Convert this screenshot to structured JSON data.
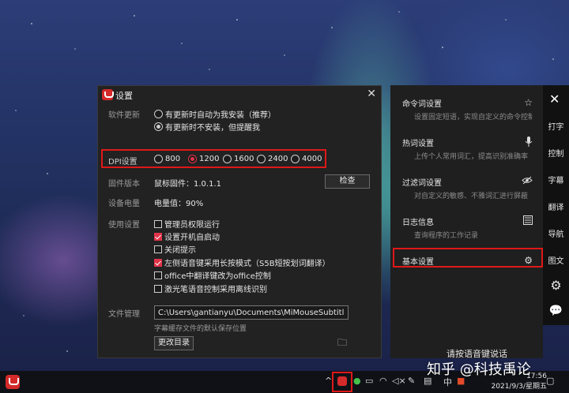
{
  "window": {
    "title": "设置",
    "software_update": {
      "label": "软件更新",
      "option_auto": "有更新时自动为我安装（推荐）",
      "option_notify": "有更新时不安装，但提醒我",
      "selected": "option_notify"
    },
    "dpi": {
      "label": "DPI设置",
      "options": [
        "800",
        "1200",
        "1600",
        "2400",
        "4000"
      ],
      "selected": "1200"
    },
    "firmware": {
      "label": "固件版本",
      "value": "鼠标固件：1.0.1.1",
      "check_button": "检查"
    },
    "battery": {
      "label": "设备电量",
      "value": "电量值：90%"
    },
    "usage": {
      "label": "使用设置",
      "options": [
        {
          "text": "管理员权限运行",
          "checked": false
        },
        {
          "text": "设置开机自启动",
          "checked": true
        },
        {
          "text": "关闭提示",
          "checked": false
        },
        {
          "text": "左侧语音键采用长按模式（S5B短按划词翻译）",
          "checked": true
        },
        {
          "text": "office中翻译键改为office控制",
          "checked": false
        },
        {
          "text": "激光笔语音控制采用离线识别",
          "checked": false
        }
      ]
    },
    "file_management": {
      "label": "文件管理",
      "path": "C:\\Users\\gantianyu\\Documents\\MiMouseSubtitle",
      "hint": "字幕缓存文件的默认保存位置",
      "change_button": "更改目录"
    }
  },
  "panel": {
    "items": [
      {
        "title": "命令词设置",
        "subtitle": "设置固定短语，实现自定义的命令控制",
        "icon": "star-icon"
      },
      {
        "title": "热词设置",
        "subtitle": "上传个人常用词汇，提高识别准确率",
        "icon": "microphone-icon"
      },
      {
        "title": "过滤词设置",
        "subtitle": "对自定义的敏感、不雅词汇进行屏蔽",
        "icon": "eye-off-icon"
      },
      {
        "title": "日志信息",
        "subtitle": "查询程序的工作记录",
        "icon": "log-icon"
      },
      {
        "title": "基本设置",
        "subtitle": "",
        "icon": "gear-icon"
      }
    ],
    "footer": "请按语音键说话"
  },
  "rail": {
    "items": [
      "打字",
      "控制",
      "字幕",
      "翻译",
      "导航",
      "图文"
    ]
  },
  "taskbar": {
    "time": "17:56",
    "date": "2021/9/3/星期五",
    "ime": "中"
  },
  "watermark": "知乎 @科技禹论",
  "colors": {
    "highlight": "#e01818",
    "accent": "#e0344a",
    "window_bg": "#222222"
  }
}
